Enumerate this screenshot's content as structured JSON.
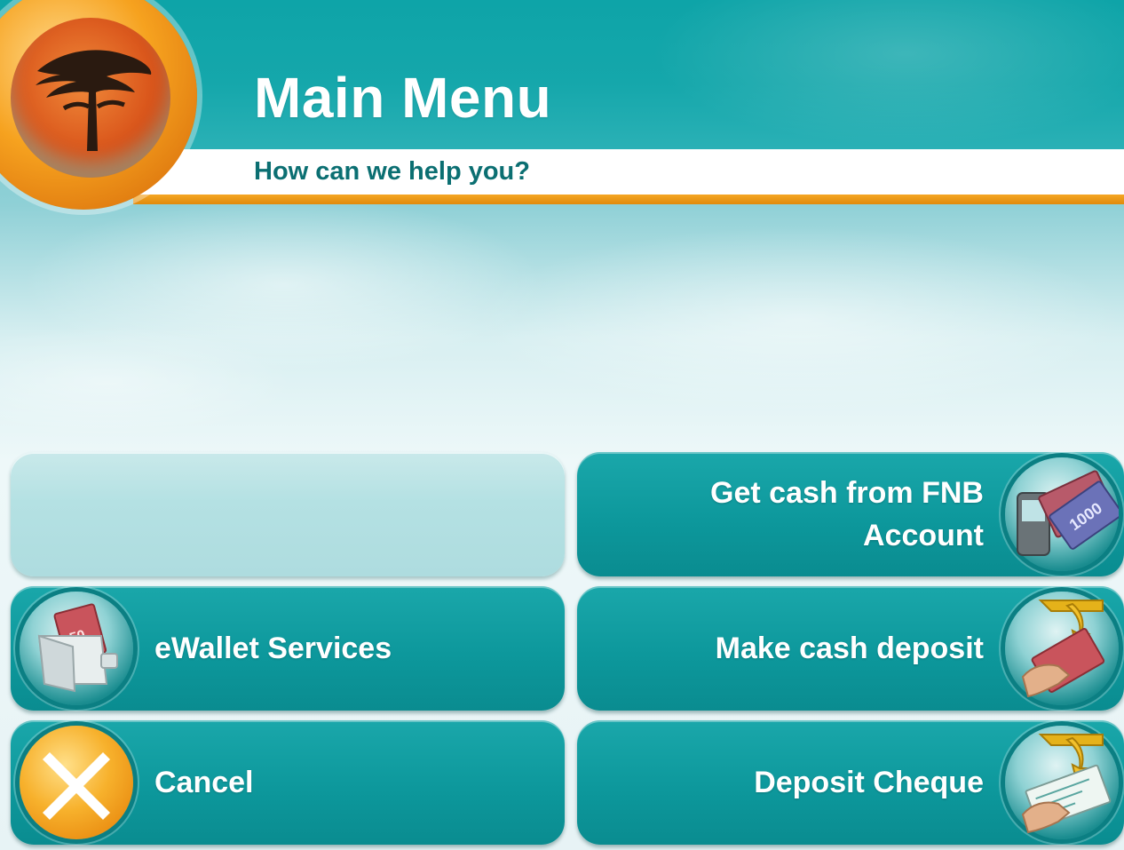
{
  "header": {
    "title": "Main Menu",
    "subtitle": "How can we help you?",
    "logo_icon": "fnb-tree-logo-icon"
  },
  "colors": {
    "teal": "#0ea4a8",
    "button_teal": "#0d989c",
    "orange": "#f5a623",
    "subtitle_text": "#0b6f72",
    "empty_button": "#b4e1e3"
  },
  "buttons": {
    "empty": {
      "label": ""
    },
    "get_cash": {
      "line1": "Get cash from FNB",
      "line2": "Account",
      "icon": "cash-phone-icon"
    },
    "ewallet": {
      "label": "eWallet Services",
      "icon": "wallet-icon"
    },
    "cash_deposit": {
      "label": "Make cash deposit",
      "icon": "cash-deposit-icon"
    },
    "cancel": {
      "label": "Cancel",
      "icon": "cancel-x-icon"
    },
    "deposit_cheque": {
      "label": "Deposit Cheque",
      "icon": "cheque-deposit-icon"
    }
  },
  "icon_text": {
    "banknote_value": "1000",
    "wallet_note_value": "50"
  }
}
